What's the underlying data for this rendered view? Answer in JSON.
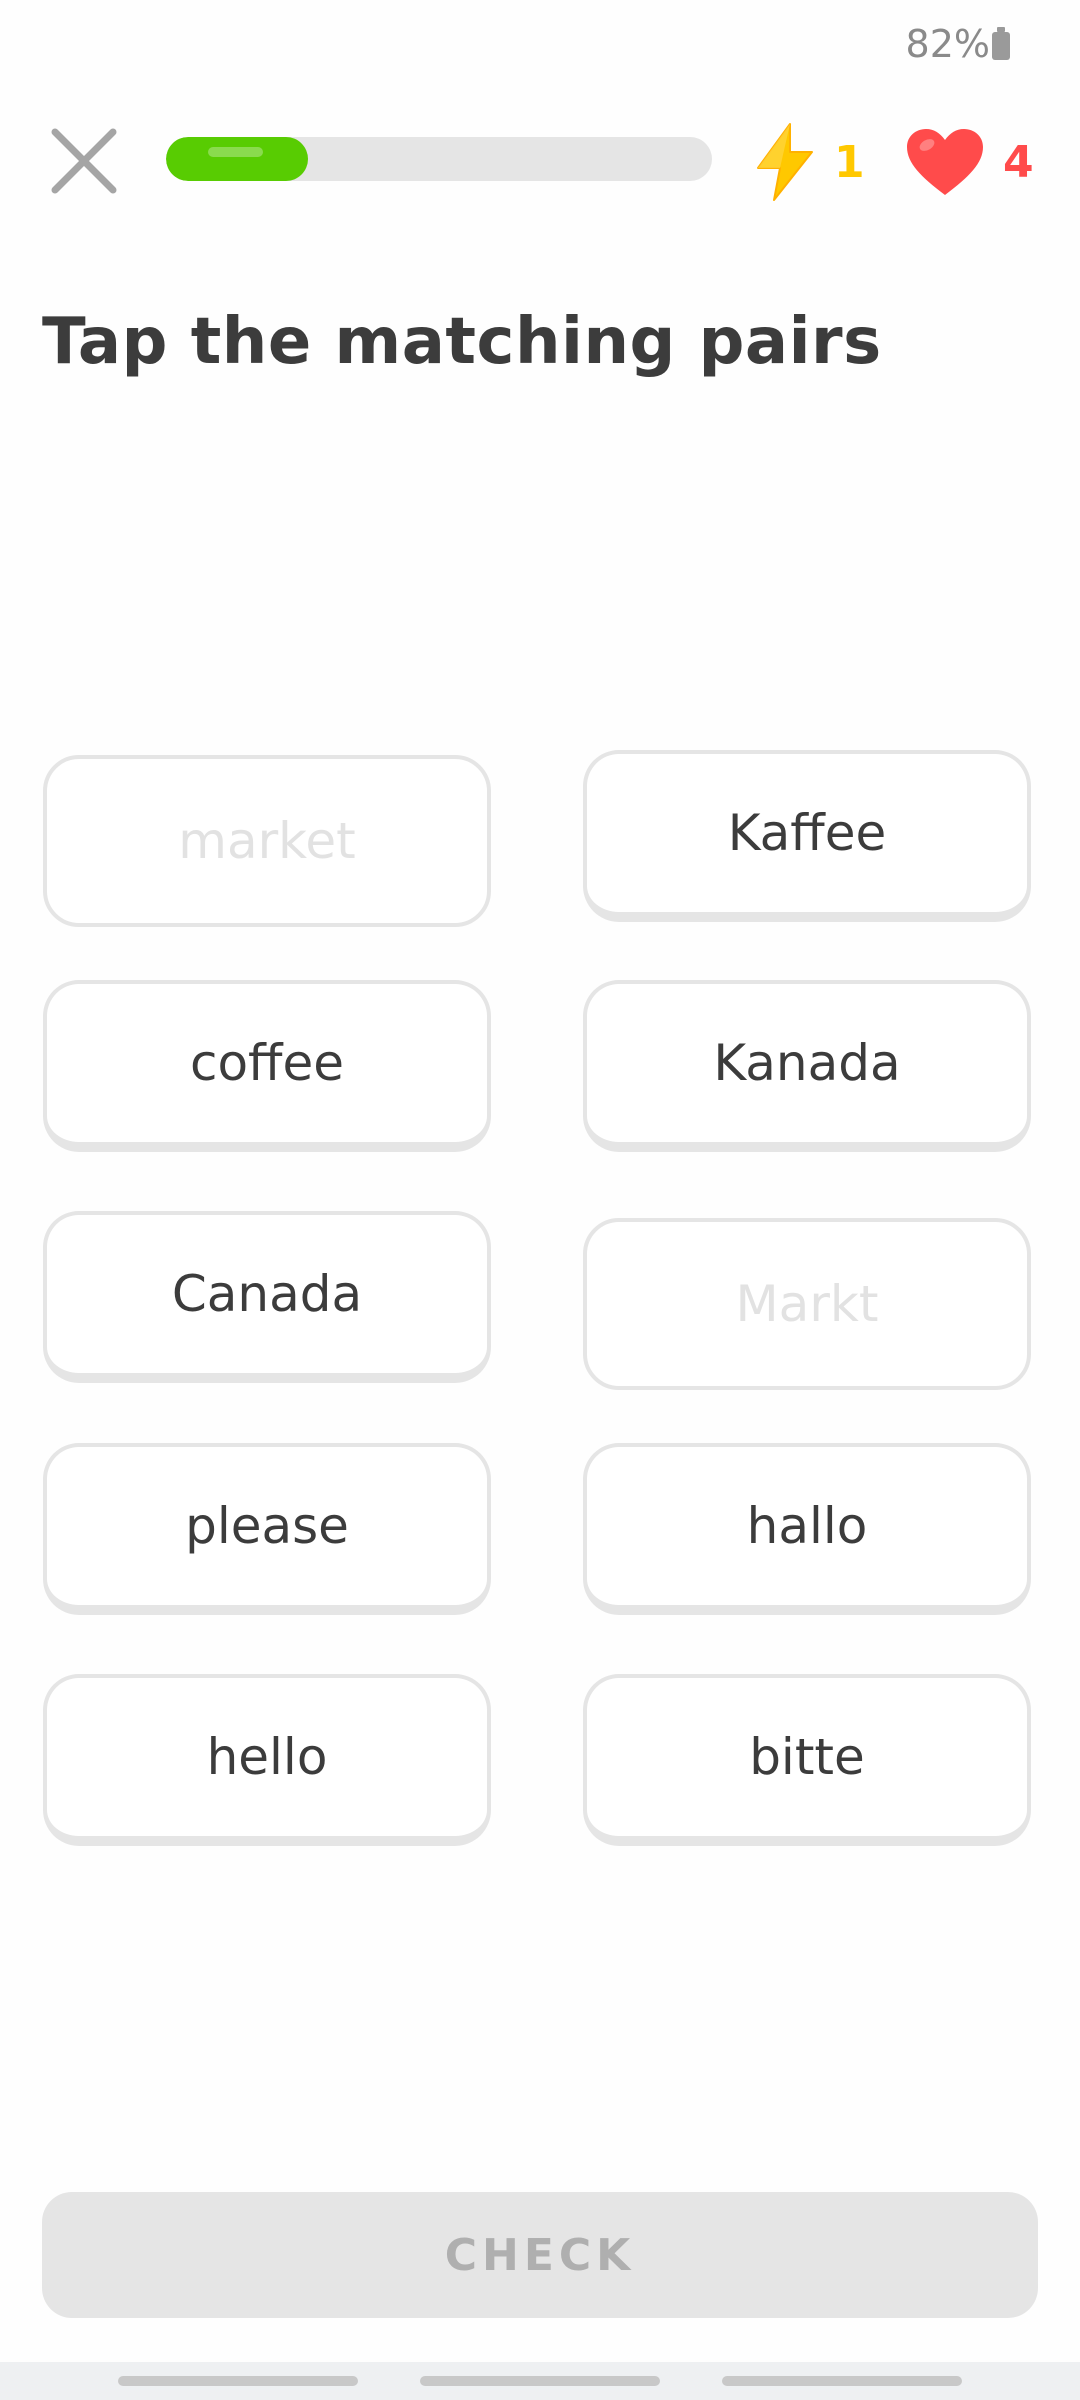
{
  "status_bar": {
    "battery_text": "82%",
    "battery_icon": "battery-icon"
  },
  "header": {
    "close_icon": "close-icon",
    "progress_percent": 26,
    "streak_icon": "lightning-bolt-icon",
    "streak_count": "1",
    "hearts_icon": "heart-icon",
    "hearts_count": "4"
  },
  "exercise": {
    "title": "Tap the matching pairs",
    "left_tiles": [
      {
        "label": "market",
        "state": "matched"
      },
      {
        "label": "coffee",
        "state": "active"
      },
      {
        "label": "Canada",
        "state": "active"
      },
      {
        "label": "please",
        "state": "active"
      },
      {
        "label": "hello",
        "state": "active"
      }
    ],
    "right_tiles": [
      {
        "label": "Kaffee",
        "state": "active"
      },
      {
        "label": "Kanada",
        "state": "active"
      },
      {
        "label": "Markt",
        "state": "matched"
      },
      {
        "label": "hallo",
        "state": "active"
      },
      {
        "label": "bitte",
        "state": "active"
      }
    ]
  },
  "footer": {
    "check_label": "CHECK"
  },
  "colors": {
    "progress_fill": "#58cc02",
    "streak": "#ffc800",
    "hearts": "#ff4b4b",
    "title_text": "#3c3c3c",
    "tile_border": "#e5e5e5",
    "matched_text": "#e2e2e2",
    "check_bg": "#e5e5e5",
    "check_text": "#afafaf"
  }
}
